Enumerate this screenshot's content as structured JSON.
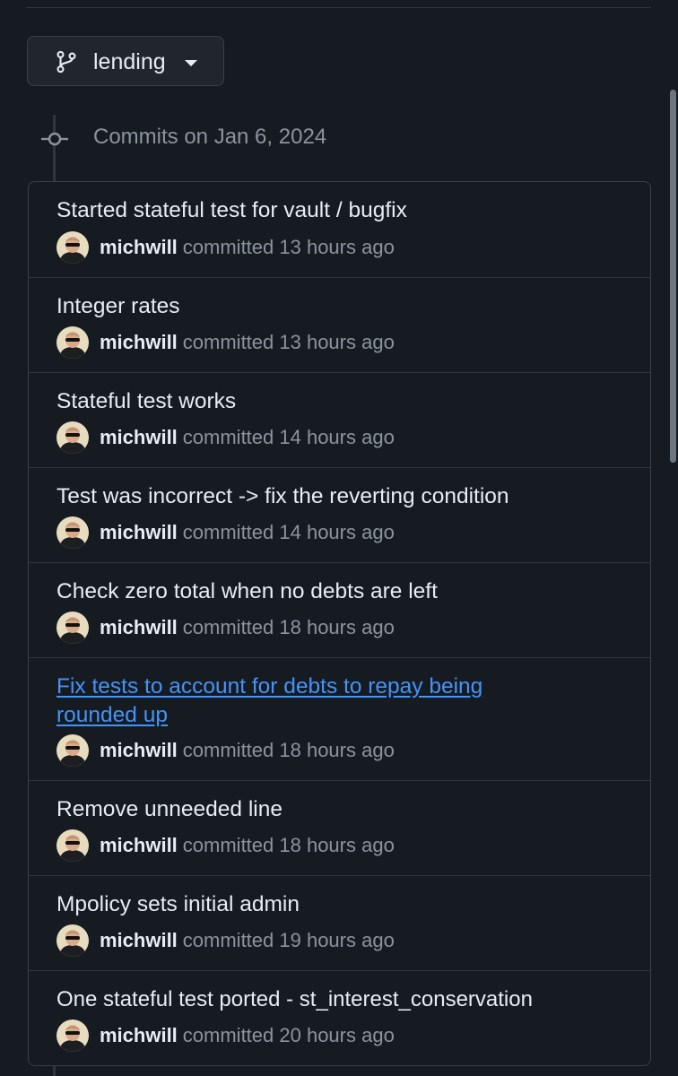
{
  "branch": {
    "name": "lending"
  },
  "timeline": {
    "heading": "Commits on Jan 6, 2024"
  },
  "commits": [
    {
      "title": "Started stateful test for vault / bugfix",
      "author": "michwill",
      "time": "committed 13 hours ago",
      "is_link": false
    },
    {
      "title": "Integer rates",
      "author": "michwill",
      "time": "committed 13 hours ago",
      "is_link": false
    },
    {
      "title": "Stateful test works",
      "author": "michwill",
      "time": "committed 14 hours ago",
      "is_link": false
    },
    {
      "title": "Test was incorrect -> fix the reverting condition",
      "author": "michwill",
      "time": "committed 14 hours ago",
      "is_link": false
    },
    {
      "title": "Check zero total when no debts are left",
      "author": "michwill",
      "time": "committed 18 hours ago",
      "is_link": false
    },
    {
      "title": "Fix tests to account for debts to repay being rounded up",
      "author": "michwill",
      "time": "committed 18 hours ago",
      "is_link": true
    },
    {
      "title": "Remove unneeded line",
      "author": "michwill",
      "time": "committed 18 hours ago",
      "is_link": false
    },
    {
      "title": "Mpolicy sets initial admin",
      "author": "michwill",
      "time": "committed 19 hours ago",
      "is_link": false
    },
    {
      "title": "One stateful test ported - st_interest_conservation",
      "author": "michwill",
      "time": "committed 20 hours ago",
      "is_link": false
    }
  ],
  "colors": {
    "background": "#161b22",
    "text": "#e6edf3",
    "muted": "#8b949e",
    "link": "#4493f8",
    "border": "#30363d"
  }
}
